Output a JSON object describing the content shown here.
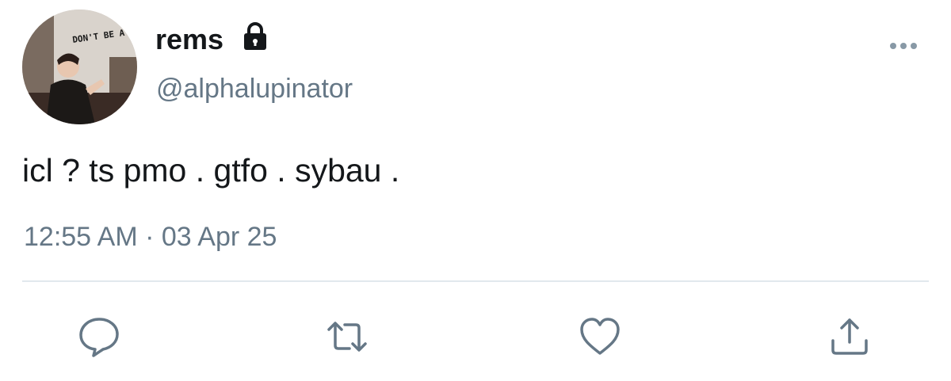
{
  "user": {
    "display_name": "rems",
    "handle": "@alphalupinator",
    "verified_lock": "lock-icon",
    "avatar_text": "DON'T BE A CUNT!"
  },
  "tweet": {
    "text": "icl ? ts pmo . gtfo . sybau .",
    "time": "12:55 AM",
    "separator": "·",
    "date": "03 Apr 25"
  },
  "actions": {
    "reply": "reply-icon",
    "retweet": "retweet-icon",
    "like": "heart-icon",
    "share": "share-icon",
    "more": "more-icon"
  },
  "colors": {
    "text": "#14171a",
    "secondary": "#657786",
    "divider": "#e1e8ed",
    "icon": "#657786"
  }
}
